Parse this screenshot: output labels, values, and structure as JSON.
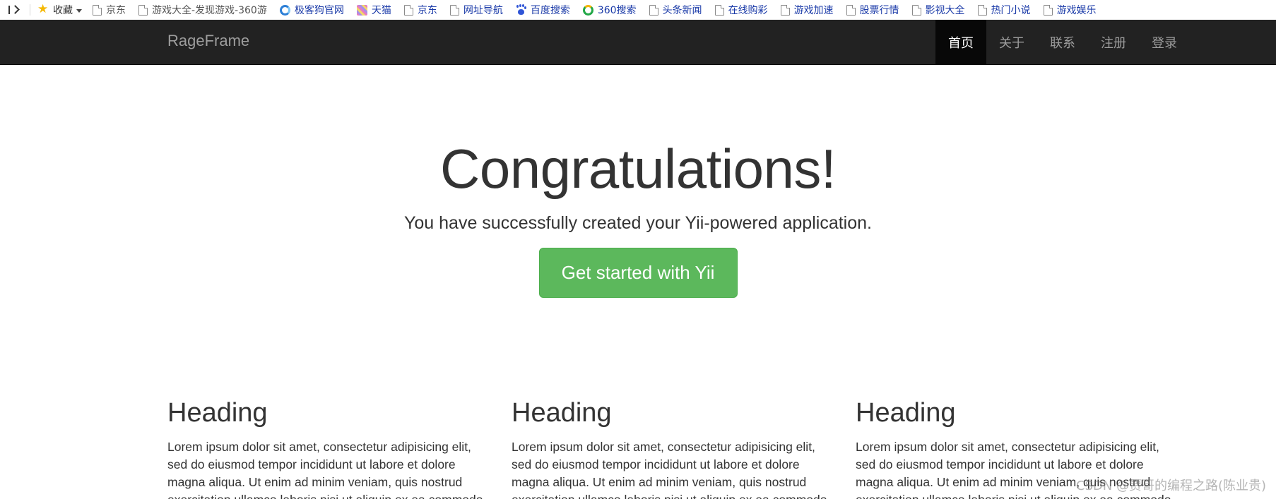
{
  "bookmarks": {
    "items": [
      {
        "label": "收藏",
        "icon": "star-icon"
      },
      {
        "label": "京东",
        "icon": "page-icon"
      },
      {
        "label": "游戏大全-发现游戏-360游",
        "icon": "page-icon"
      },
      {
        "label": "极客狗官网",
        "icon": "swirl-icon"
      },
      {
        "label": "天猫",
        "icon": "cat-icon"
      },
      {
        "label": "京东",
        "icon": "page-icon"
      },
      {
        "label": "网址导航",
        "icon": "page-icon"
      },
      {
        "label": "百度搜索",
        "icon": "paw-icon"
      },
      {
        "label": "360搜索",
        "icon": "ring-icon"
      },
      {
        "label": "头条新闻",
        "icon": "page-icon"
      },
      {
        "label": "在线购彩",
        "icon": "page-icon"
      },
      {
        "label": "游戏加速",
        "icon": "page-icon"
      },
      {
        "label": "股票行情",
        "icon": "page-icon"
      },
      {
        "label": "影视大全",
        "icon": "page-icon"
      },
      {
        "label": "热门小说",
        "icon": "page-icon"
      },
      {
        "label": "游戏娱乐",
        "icon": "page-icon"
      }
    ]
  },
  "navbar": {
    "brand": "RageFrame",
    "items": [
      {
        "label": "首页",
        "active": true
      },
      {
        "label": "关于",
        "active": false
      },
      {
        "label": "联系",
        "active": false
      },
      {
        "label": "注册",
        "active": false
      },
      {
        "label": "登录",
        "active": false
      }
    ]
  },
  "jumbotron": {
    "title": "Congratulations!",
    "lead": "You have successfully created your Yii-powered application.",
    "button_label": "Get started with Yii"
  },
  "columns": [
    {
      "heading": "Heading",
      "text": "Lorem ipsum dolor sit amet, consectetur adipisicing elit, sed do eiusmod tempor incididunt ut labore et dolore magna aliqua. Ut enim ad minim veniam, quis nostrud exercitation ullamco laboris nisi ut aliquip ex ea commodo"
    },
    {
      "heading": "Heading",
      "text": "Lorem ipsum dolor sit amet, consectetur adipisicing elit, sed do eiusmod tempor incididunt ut labore et dolore magna aliqua. Ut enim ad minim veniam, quis nostrud exercitation ullamco laboris nisi ut aliquip ex ea commodo"
    },
    {
      "heading": "Heading",
      "text": "Lorem ipsum dolor sit amet, consectetur adipisicing elit, sed do eiusmod tempor incididunt ut labore et dolore magna aliqua. Ut enim ad minim veniam, quis nostrud exercitation ullamco laboris nisi ut aliquip ex ea commodo"
    }
  ],
  "watermark": "CSDN @贾哥的编程之路(陈业贵)",
  "colors": {
    "navbar_bg": "#222222",
    "navbar_active_bg": "#080808",
    "navbar_text": "#9d9d9d",
    "success": "#5cb85c",
    "text": "#333333"
  }
}
